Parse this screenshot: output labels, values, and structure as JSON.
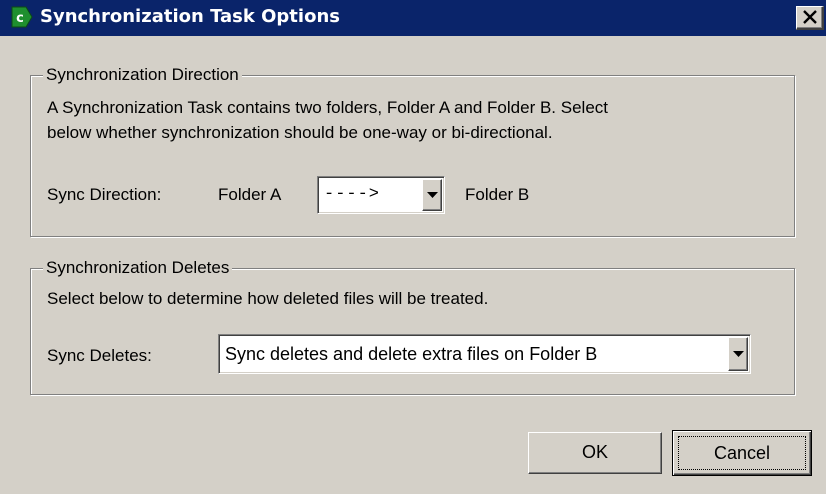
{
  "window": {
    "title": "Synchronization Task Options",
    "titlebar_color": "#0a246a",
    "face_color": "#d4d0c8",
    "icon": "app-c-arrow-icon",
    "close_icon": "close-x-icon"
  },
  "direction_group": {
    "legend": "Synchronization Direction",
    "description_line1": "A Synchronization Task contains two folders, Folder A and Folder B. Select",
    "description_line2": "below whether synchronization should be one-way or bi-directional.",
    "sync_direction_label": "Sync Direction:",
    "folder_a_label": "Folder A",
    "direction_value": "---->",
    "folder_b_label": "Folder B"
  },
  "deletes_group": {
    "legend": "Synchronization Deletes",
    "description": "Select below to determine how deleted files will be treated.",
    "sync_deletes_label": "Sync Deletes:",
    "deletes_value": "Sync deletes and delete extra files on Folder B"
  },
  "buttons": {
    "ok_label": "OK",
    "cancel_label": "Cancel"
  }
}
